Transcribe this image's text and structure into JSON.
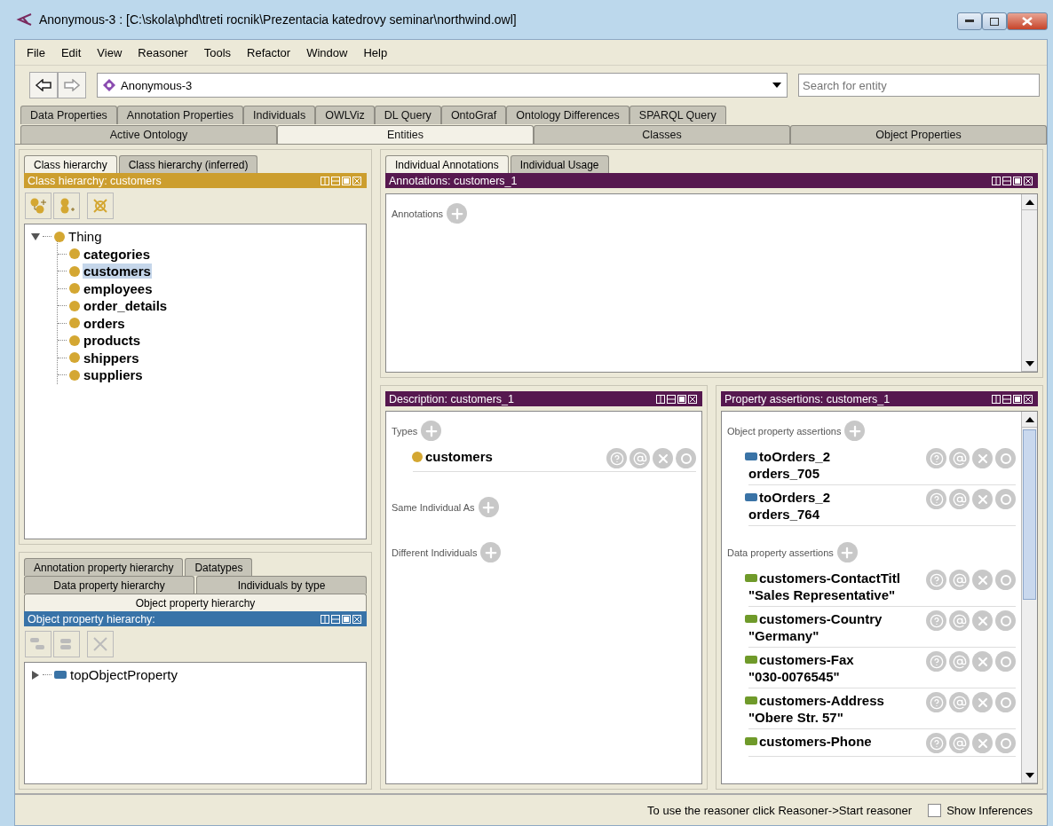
{
  "window": {
    "title": "Anonymous-3 : [C:\\skola\\phd\\treti rocnik\\Prezentacia katedrovy seminar\\northwind.owl]"
  },
  "menu": [
    "File",
    "Edit",
    "View",
    "Reasoner",
    "Tools",
    "Refactor",
    "Window",
    "Help"
  ],
  "toolbar": {
    "ontology": "Anonymous-3",
    "search": {
      "placeholder": "Search for entity"
    }
  },
  "tabs_row1": [
    {
      "label": "Data Properties",
      "selected": false
    },
    {
      "label": "Annotation Properties",
      "selected": false
    },
    {
      "label": "Individuals",
      "selected": false
    },
    {
      "label": "OWLViz",
      "selected": false
    },
    {
      "label": "DL Query",
      "selected": false
    },
    {
      "label": "OntoGraf",
      "selected": false
    },
    {
      "label": "Ontology Differences",
      "selected": false
    },
    {
      "label": "SPARQL Query",
      "selected": false
    }
  ],
  "tabs_row2": [
    {
      "label": "Active Ontology",
      "selected": false
    },
    {
      "label": "Entities",
      "selected": true
    },
    {
      "label": "Classes",
      "selected": false
    },
    {
      "label": "Object Properties",
      "selected": false
    }
  ],
  "class_panel": {
    "tabs": [
      {
        "label": "Class hierarchy",
        "selected": true
      },
      {
        "label": "Class hierarchy (inferred)",
        "selected": false
      }
    ],
    "title": "Class hierarchy: customers",
    "tree": [
      {
        "label": "Thing",
        "expanded": true,
        "selected": false,
        "children": [
          {
            "label": "categories",
            "selected": false
          },
          {
            "label": "customers",
            "selected": true
          },
          {
            "label": "employees",
            "selected": false
          },
          {
            "label": "order_details",
            "selected": false
          },
          {
            "label": "orders",
            "selected": false
          },
          {
            "label": "products",
            "selected": false
          },
          {
            "label": "shippers",
            "selected": false
          },
          {
            "label": "suppliers",
            "selected": false
          }
        ]
      }
    ]
  },
  "property_panel": {
    "tab_rows": [
      [
        {
          "label": "Annotation property hierarchy",
          "selected": false
        },
        {
          "label": "Datatypes",
          "selected": false
        }
      ],
      [
        {
          "label": "Data property hierarchy",
          "selected": false
        },
        {
          "label": "Individuals by type",
          "selected": false
        }
      ],
      [
        {
          "label": "Object property hierarchy",
          "selected": true
        }
      ]
    ],
    "title": "Object property hierarchy:",
    "tree": [
      {
        "label": "topObjectProperty",
        "expanded": false,
        "selected": false
      }
    ]
  },
  "individual_tabs": [
    {
      "label": "Individual Annotations",
      "selected": true
    },
    {
      "label": "Individual Usage",
      "selected": false
    }
  ],
  "annotations": {
    "title": "Annotations: customers_1",
    "section": "Annotations"
  },
  "description": {
    "title": "Description: customers_1",
    "sections": [
      {
        "label": "Types",
        "items": [
          "customers"
        ]
      },
      {
        "label": "Same Individual As"
      },
      {
        "label": "Different Individuals"
      }
    ]
  },
  "assertions": {
    "title": "Property assertions: customers_1",
    "sections": [
      {
        "label": "Object property assertions",
        "items": [
          {
            "kind": "object",
            "property": "toOrders_2",
            "value": "orders_705"
          },
          {
            "kind": "object",
            "property": "toOrders_2",
            "value": "orders_764"
          }
        ]
      },
      {
        "label": "Data property assertions",
        "items": [
          {
            "kind": "data",
            "property": "customers-ContactTitl",
            "value": "\"Sales Representative\""
          },
          {
            "kind": "data",
            "property": "customers-Country",
            "value": "\"Germany\""
          },
          {
            "kind": "data",
            "property": "customers-Fax",
            "value": "\"030-0076545\""
          },
          {
            "kind": "data",
            "property": "customers-Address",
            "value": "\"Obere Str. 57\""
          },
          {
            "kind": "data",
            "property": "customers-Phone"
          }
        ]
      }
    ]
  },
  "status_bar": {
    "message": "To use the reasoner click Reasoner->Start reasoner",
    "show_inferences": {
      "label": "Show Inferences",
      "checked": false
    }
  }
}
